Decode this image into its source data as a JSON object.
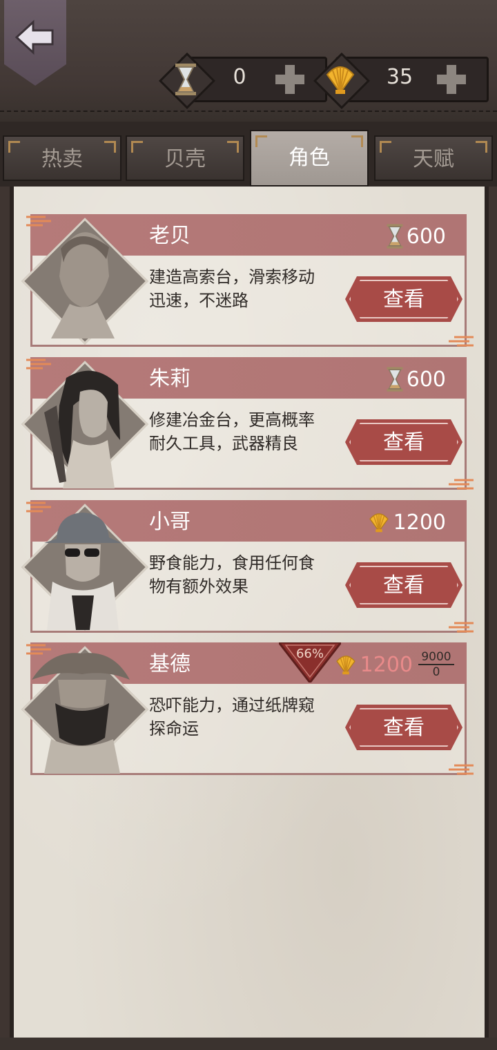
{
  "currencies": {
    "hourglass": {
      "amount": "0"
    },
    "shell": {
      "amount": "35"
    }
  },
  "tabs": [
    {
      "label": "热卖",
      "active": false
    },
    {
      "label": "贝壳",
      "active": false
    },
    {
      "label": "角色",
      "active": true
    },
    {
      "label": "天赋",
      "active": false
    }
  ],
  "characters": [
    {
      "name": "老贝",
      "desc": "建造高索台，滑索移动迅速，不迷路",
      "price_icon": "hourglass-icon",
      "price": "600",
      "button": "查看"
    },
    {
      "name": "朱莉",
      "desc": "修建冶金台，更高概率耐久工具，武器精良",
      "price_icon": "hourglass-icon",
      "price": "600",
      "button": "查看"
    },
    {
      "name": "小哥",
      "desc": "野食能力，食用任何食物有额外效果",
      "price_icon": "shell-icon",
      "price": "1200",
      "button": "查看"
    },
    {
      "name": "基德",
      "desc": "恐吓能力，通过纸牌窥探命运",
      "price_icon": "shell-icon",
      "price": "1200",
      "discount": "66%",
      "progress_top": "9000",
      "progress_bottom": "0",
      "button": "查看"
    }
  ],
  "colors": {
    "header": "#b57a79",
    "button": "#a84b47",
    "parchment": "#e3ded4",
    "leather": "#423835"
  }
}
